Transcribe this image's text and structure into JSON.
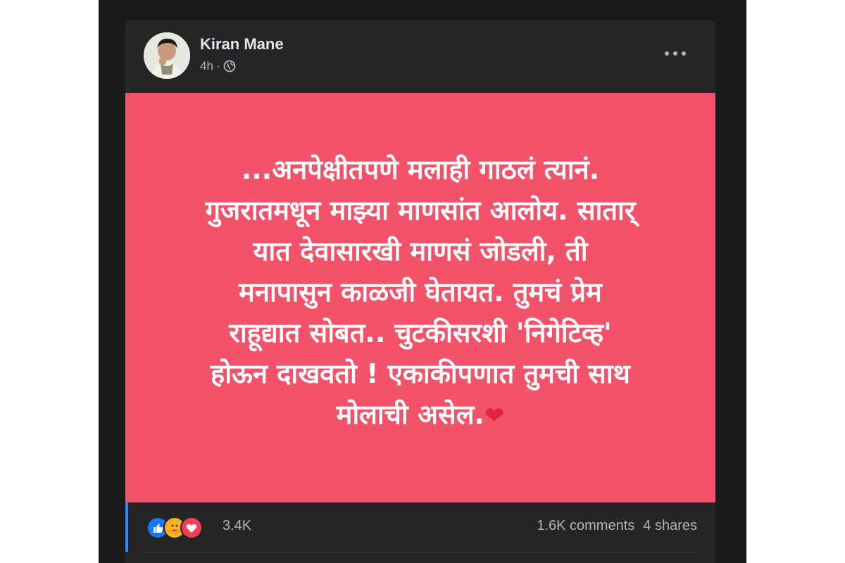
{
  "post": {
    "author": "Kiran Mane",
    "time": "4h",
    "separator": "·",
    "privacy_icon": "globe-icon",
    "more_icon": "more-horizontal-icon",
    "banner_bg": "#f2536b",
    "text": "...अनपेक्षीतपणे मलाही गाठलं त्यानं.\nगुजरातमधून माझ्या माणसांत आलोय. सातार्\nयात देवासारखी माणसं जोडली, ती\nमनापासुन काळजी घेतायत. तुमचं प्रेम\nराहूद्यात सोबत.. चुटकीसरशी 'निगेटिव्ह'\nहोऊन दाखवतो ! एकाकीपणात तुमची साथ\nमोलाची असेल.",
    "heart": "❤"
  },
  "engagement": {
    "reaction_icons": [
      "like-icon",
      "care-icon",
      "love-icon"
    ],
    "reactions_count": "3.4K",
    "comments": "1.6K comments",
    "shares": "4 shares"
  }
}
